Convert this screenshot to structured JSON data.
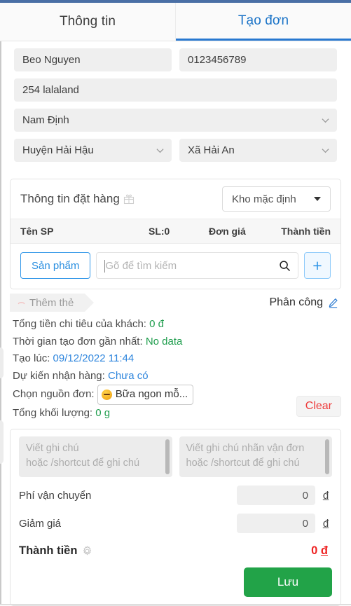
{
  "tabs": [
    {
      "label": "Thông tin",
      "active": false
    },
    {
      "label": "Tạo đơn",
      "active": true
    }
  ],
  "customer": {
    "name": "Beo Nguyen",
    "phone": "0123456789",
    "address": "254 lalaland",
    "province": "Nam Định",
    "district": "Huyện Hải Hậu",
    "ward": "Xã Hải An"
  },
  "order_card": {
    "title": "Thông tin đặt hàng",
    "gift_icon": "gift-icon",
    "warehouse": "Kho mặc định",
    "columns": {
      "name": "Tên SP",
      "quantity": "SL:0",
      "price": "Đơn giá",
      "total": "Thành tiền"
    },
    "product_button": "Sản phẩm",
    "search_placeholder": "Gõ để tìm kiếm",
    "search_icon": "search-icon",
    "add_button": "+"
  },
  "tag_row": {
    "add_tag": "Thêm thẻ",
    "assign": "Phân công",
    "edit_icon": "pencil-icon"
  },
  "info": {
    "total_spent_label": "Tổng tiền chi tiêu của khách:",
    "total_spent_value": "0 đ",
    "last_order_label": "Thời gian tạo đơn gần nhất:",
    "last_order_value": "No data",
    "created_label": "Tạo lúc:",
    "created_value": "09/12/2022 11:44",
    "expected_label": "Dự kiến nhận hàng:",
    "expected_value": "Chưa có",
    "source_label": "Chọn nguồn đơn:",
    "source_value": "Bữa ngon mỗ...",
    "source_emoji": "neutral-face-emoji",
    "weight_label": "Tổng khối lượng:",
    "weight_value": "0 g",
    "clear_button": "Clear"
  },
  "notes": {
    "order_note_line1": "Viết ghi chú",
    "order_note_line2": "hoặc /shortcut để ghi chú",
    "shipping_note_line1": "Viết ghi chú nhãn vận đơn",
    "shipping_note_line2": "hoặc /shortcut để ghi chú"
  },
  "totals": {
    "shipping_label": "Phí vận chuyển",
    "shipping_value": "0",
    "discount_label": "Giảm giá",
    "discount_value": "0",
    "currency": "đ",
    "grand_label": "Thành tiền",
    "grand_gear_icon": "gear-icon",
    "grand_value_number": "0",
    "grand_value_currency": "đ",
    "save_button": "Lưu"
  },
  "colors": {
    "accent_blue": "#2878d0",
    "green": "#1f9d4d",
    "red": "#ee2222",
    "save_green": "#22a348",
    "chrome": "#4a6fa5"
  }
}
